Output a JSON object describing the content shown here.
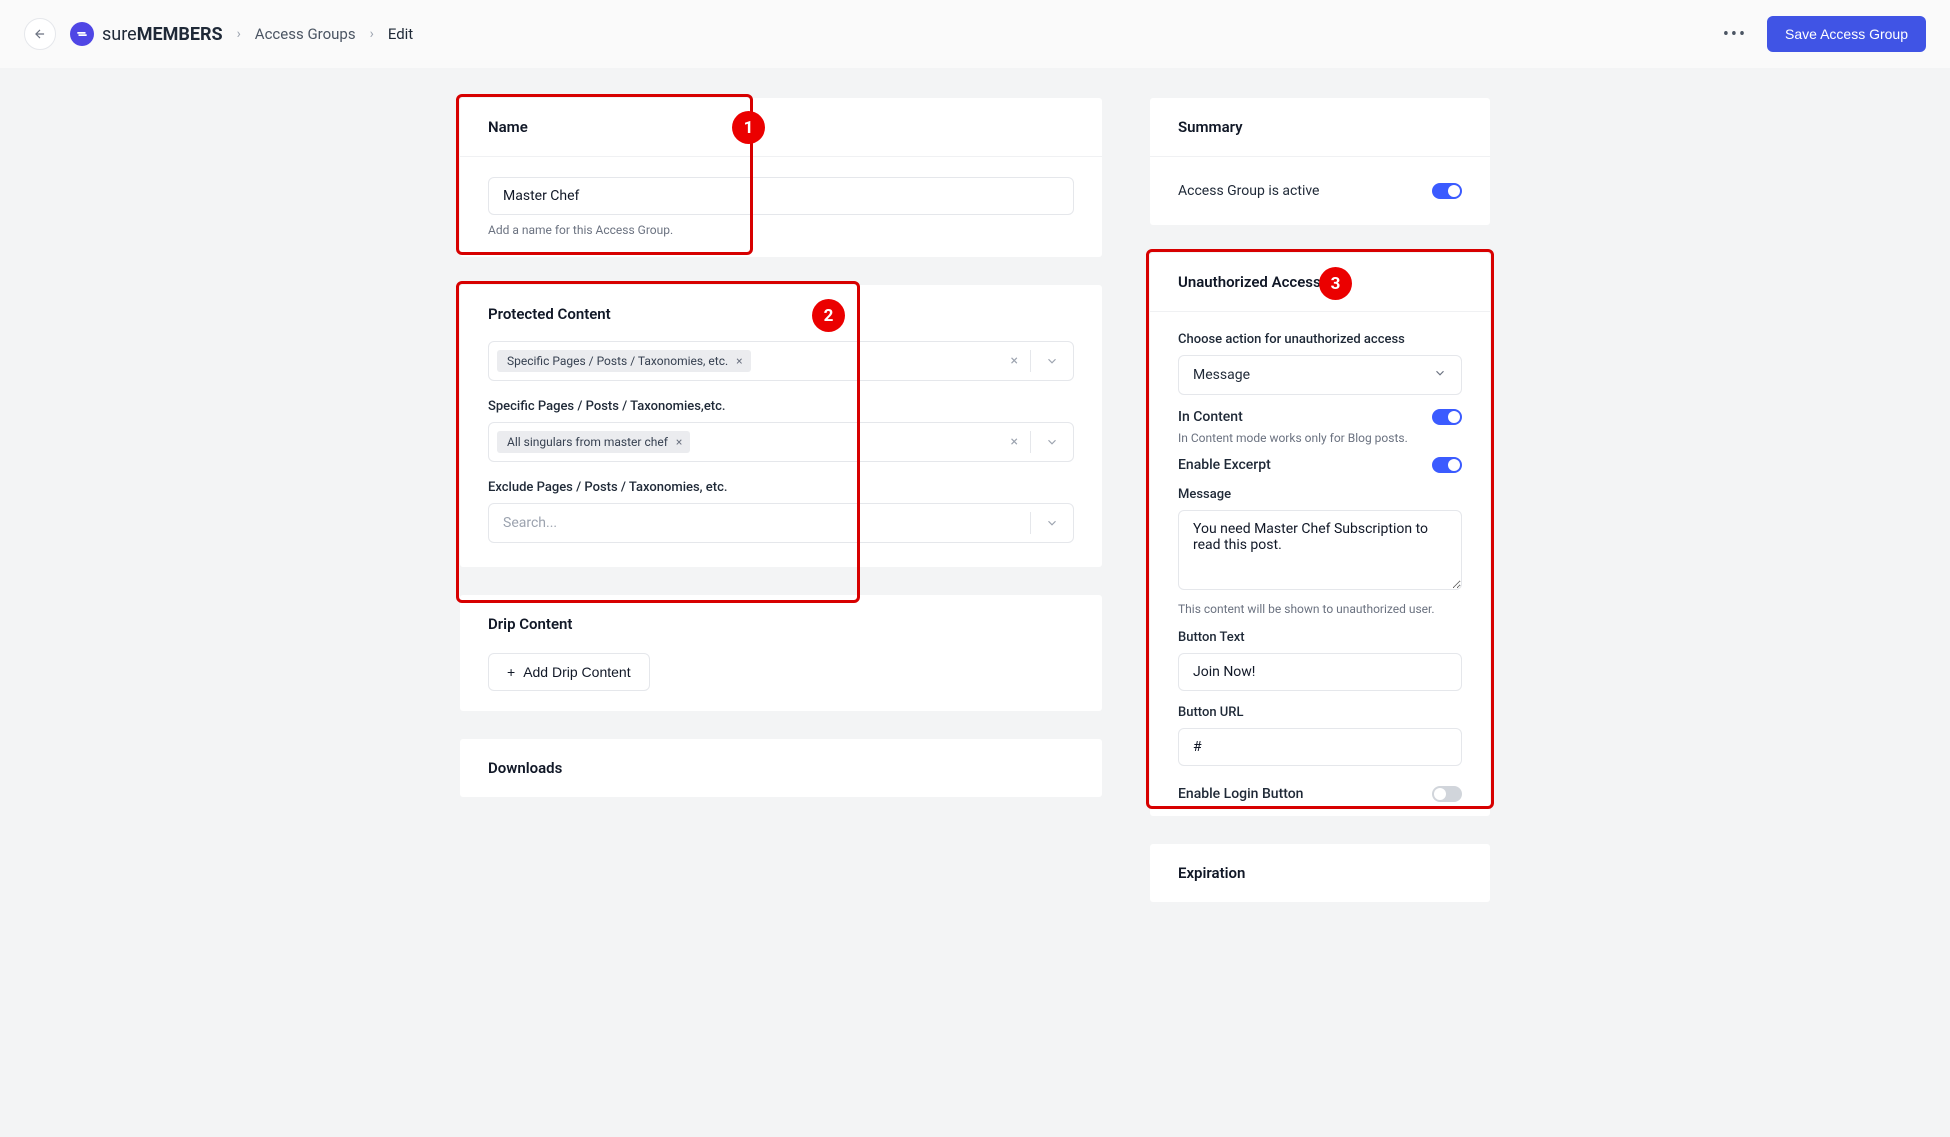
{
  "topbar": {
    "brand_prefix": "sure",
    "brand_suffix": "MEMBERS",
    "crumb1": "Access Groups",
    "crumb2": "Edit",
    "save_label": "Save Access Group"
  },
  "name_card": {
    "title": "Name",
    "value": "Master Chef",
    "help": "Add a name for this Access Group."
  },
  "protected": {
    "title": "Protected Content",
    "tag1": "Specific Pages / Posts / Taxonomies, etc.",
    "specific_label": "Specific Pages / Posts / Taxonomies,etc.",
    "tag2": "All singulars from master chef",
    "exclude_label": "Exclude Pages / Posts / Taxonomies, etc.",
    "exclude_placeholder": "Search..."
  },
  "drip": {
    "title": "Drip Content",
    "button": "Add Drip Content"
  },
  "downloads": {
    "title": "Downloads"
  },
  "summary": {
    "title": "Summary",
    "active_label": "Access Group is active",
    "active_on": true
  },
  "unauth": {
    "title": "Unauthorized Access",
    "action_label": "Choose action for unauthorized access",
    "action_value": "Message",
    "in_content_label": "In Content",
    "in_content_help": "In Content mode works only for Blog posts.",
    "in_content_on": true,
    "excerpt_label": "Enable Excerpt",
    "excerpt_on": true,
    "message_label": "Message",
    "message_value": "You need Master Chef Subscription to read this post.",
    "message_help": "This content will be shown to unauthorized user.",
    "btn_text_label": "Button Text",
    "btn_text_value": "Join Now!",
    "btn_url_label": "Button URL",
    "btn_url_value": "#",
    "login_btn_label": "Enable Login Button",
    "login_btn_on": false
  },
  "expiration": {
    "title": "Expiration"
  },
  "badges": {
    "one": "1",
    "two": "2",
    "three": "3"
  }
}
